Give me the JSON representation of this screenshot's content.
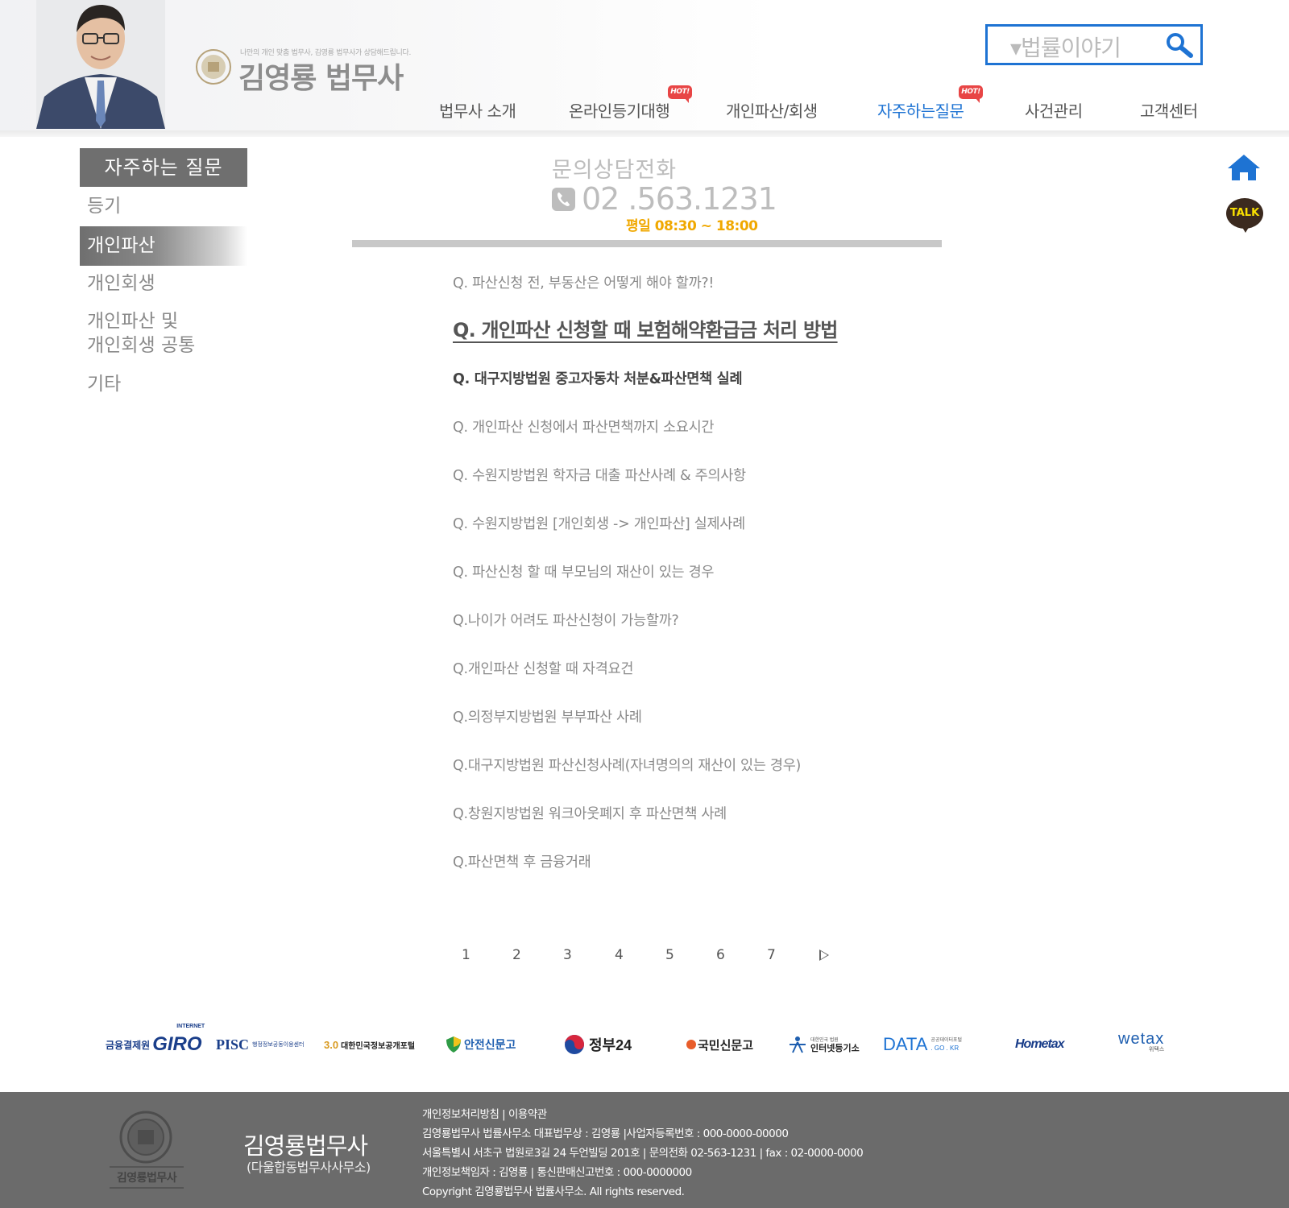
{
  "header": {
    "tagline": "나만의 개인 맞춤 법무사, 김영룡 법무사가 상담해드립니다.",
    "brand_name": "김영룡 법무사",
    "search_placeholder": "▾법률이야기",
    "nav": [
      {
        "label": "법무사 소개"
      },
      {
        "label": "온라인등기대행",
        "badge": "HOT!"
      },
      {
        "label": "개인파산/회생"
      },
      {
        "label": "자주하는질문",
        "badge": "HOT!"
      },
      {
        "label": "사건관리"
      },
      {
        "label": "고객센터"
      }
    ]
  },
  "sidebar": {
    "title": "자주하는 질문",
    "items": [
      {
        "label": "등기"
      },
      {
        "label": "개인파산"
      },
      {
        "label": "개인회생"
      },
      {
        "label": "개인파산 및"
      },
      {
        "label": "개인회생 공통"
      },
      {
        "label": "기타"
      }
    ]
  },
  "contact": {
    "title": "문의상담전화",
    "phone": "02 .563.1231",
    "hours": "평일 08:30 ~ 18:00"
  },
  "questions": [
    "Q. 파산신청 전, 부동산은 어떻게 해야 할까?!",
    "Q. 개인파산 신청할 때 보험해약환급금 처리 방법",
    "Q. 대구지방법원 중고자동차 처분&파산면책 실례",
    "Q. 개인파산 신청에서 파산면책까지 소요시간",
    "Q. 수원지방법원 학자금 대출 파산사례 & 주의사항",
    "Q. 수원지방법원 [개인회생 -> 개인파산] 실제사례",
    "Q. 파산신청 할 때 부모님의 재산이 있는 경우",
    "Q.나이가 어려도 파산신청이 가능할까?",
    "Q.개인파산 신청할 때 자격요건",
    "Q.의정부지방법원 부부파산 사례",
    "Q.대구지방법원 파산신청사례(자녀명의의 재산이 있는 경우)",
    "Q.창원지방법원 워크아웃폐지 후 파산면책 사례",
    "Q.파산면책 후 금융거래"
  ],
  "pagination": [
    "1",
    "2",
    "3",
    "4",
    "5",
    "6",
    "7"
  ],
  "floating": {
    "talk_label": "TALK"
  },
  "partners": {
    "giro_prefix": "금융결제원",
    "giro_small": "INTERNET",
    "giro_main": "GIRO",
    "pisc_main": "PISC",
    "pisc_sub": "행정정보공동이용센터",
    "opengov_num": "3.0",
    "opengov_name": "대한민국정보공개포털",
    "safety": "안전신문고",
    "gov24": "정부24",
    "epeople": "국민신문고",
    "iros_small": "대한민국 법원",
    "iros_main": "인터넷등기소",
    "data_main": "DATA",
    "data_small": "공공데이터포털",
    "data_domain": ". GO . KR",
    "hometax": "Hometax",
    "wetax": "wetax",
    "wetax_sub": "위택스"
  },
  "footer": {
    "logo_text": "김영룡법무사",
    "company": "김영룡법무사",
    "company_sub": "(다울합동법무사사무소)",
    "lines": [
      "개인정보처리방침 | 이용약관",
      "김영룡법무사 법률사무소  대표법무상 : 김영룡  |사업자등록번호 : 000-0000-00000",
      "서울특별시 서초구 법원로3길 24 두언빌딩 201호 | 문의전화 02-563-1231 | fax : 02-0000-0000",
      "개인정보책임자 : 김영룡  | 통신판매신고번호 : 000-0000000",
      "Copyright 김영룡법무사 법률사무소. All rights reserved."
    ]
  },
  "colors": {
    "accent": "#1e73d3",
    "hot": "#e84545",
    "hours": "#f0a800",
    "footer_bg": "#6b6b6b"
  }
}
